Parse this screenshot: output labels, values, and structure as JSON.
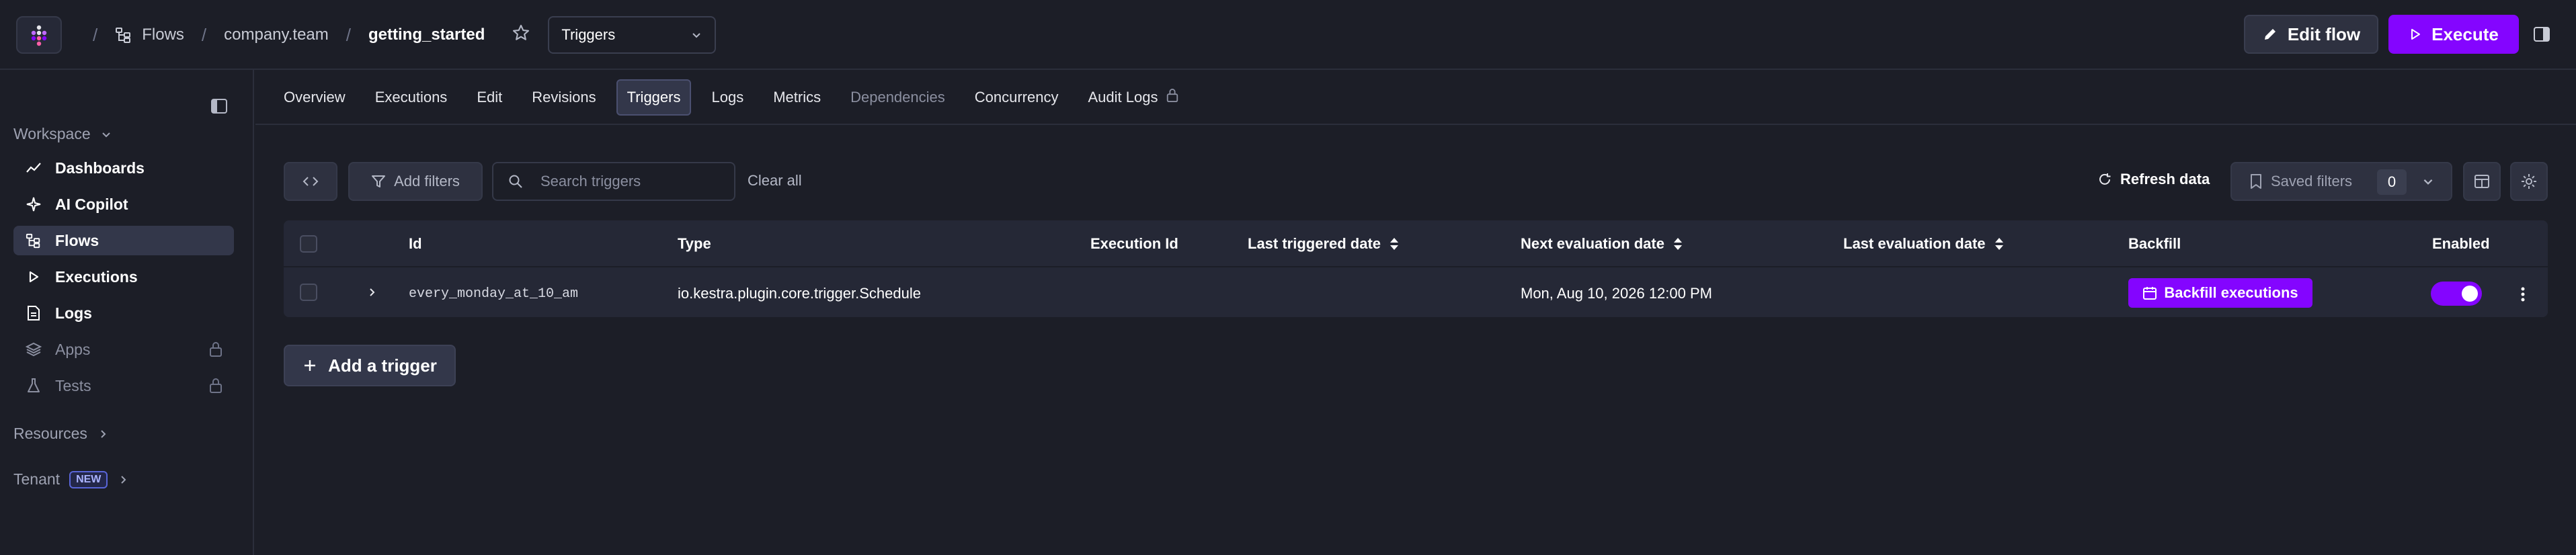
{
  "breadcrumb": {
    "flows": "Flows",
    "namespace": "company.team",
    "flow": "getting_started"
  },
  "header": {
    "view_select": "Triggers",
    "edit_flow": "Edit flow",
    "execute": "Execute"
  },
  "sidebar": {
    "workspace": "Workspace",
    "items": [
      {
        "label": "Dashboards",
        "icon": "chart-line-icon"
      },
      {
        "label": "AI Copilot",
        "icon": "sparkle-icon"
      },
      {
        "label": "Flows",
        "icon": "flow-icon"
      },
      {
        "label": "Executions",
        "icon": "play-icon"
      },
      {
        "label": "Logs",
        "icon": "file-icon"
      },
      {
        "label": "Apps",
        "icon": "layers-icon"
      },
      {
        "label": "Tests",
        "icon": "flask-icon"
      }
    ],
    "resources": "Resources",
    "tenant": "Tenant",
    "new_badge": "NEW"
  },
  "tabs": [
    "Overview",
    "Executions",
    "Edit",
    "Revisions",
    "Triggers",
    "Logs",
    "Metrics",
    "Dependencies",
    "Concurrency",
    "Audit Logs"
  ],
  "toolbar": {
    "add_filters": "Add filters",
    "search_placeholder": "Search triggers",
    "clear_all": "Clear all",
    "refresh": "Refresh data",
    "saved_filters": "Saved filters",
    "saved_count": "0"
  },
  "table": {
    "columns": [
      "Id",
      "Type",
      "Execution Id",
      "Last triggered date",
      "Next evaluation date",
      "Last evaluation date",
      "Backfill",
      "Enabled"
    ],
    "rows": [
      {
        "id": "every_monday_at_10_am",
        "type": "io.kestra.plugin.core.trigger.Schedule",
        "execution_id": "",
        "last_triggered": "",
        "next_evaluation": "Mon, Aug 10, 2026 12:00 PM",
        "last_evaluation": "",
        "backfill_label": "Backfill executions",
        "enabled": true
      }
    ]
  },
  "add_trigger": "Add a trigger",
  "colors": {
    "accent": "#8405ff",
    "background": "#1c1e27",
    "panel": "#252836"
  }
}
